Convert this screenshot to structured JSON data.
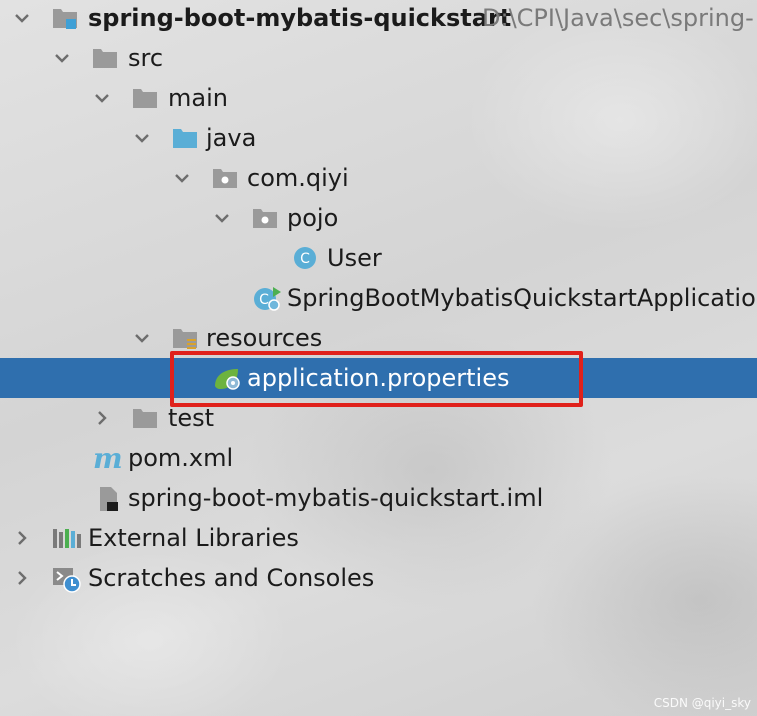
{
  "project": {
    "name": "spring-boot-mybatis-quickstart",
    "path": "D:\\CPI\\Java\\sec\\spring-"
  },
  "tree": {
    "src": "src",
    "main": "main",
    "java": "java",
    "package": "com.qiyi",
    "pojo": "pojo",
    "user_class": "User",
    "app_class": "SpringBootMybatisQuickstartApplication",
    "resources": "resources",
    "properties_file": "application.properties",
    "test": "test",
    "pom": "pom.xml",
    "iml": "spring-boot-mybatis-quickstart.iml",
    "external_libraries": "External Libraries",
    "scratches": "Scratches and Consoles"
  },
  "watermark": "CSDN @qiyi_sky",
  "colors": {
    "selection": "#2f6fae",
    "highlight_border": "#e0211b",
    "folder": "#9a9a9a",
    "source_folder": "#5aaed6",
    "class_icon": "#5aaed6"
  },
  "icons": {
    "project": "module-folder-icon",
    "folder": "folder-icon",
    "source_folder": "source-folder-icon",
    "package": "package-icon",
    "class": "class-icon",
    "spring_app": "spring-boot-app-icon",
    "resources": "resources-folder-icon",
    "spring_properties": "spring-properties-icon",
    "maven": "maven-icon",
    "iml": "iml-file-icon",
    "libraries": "libraries-icon",
    "scratches": "scratches-icon"
  }
}
